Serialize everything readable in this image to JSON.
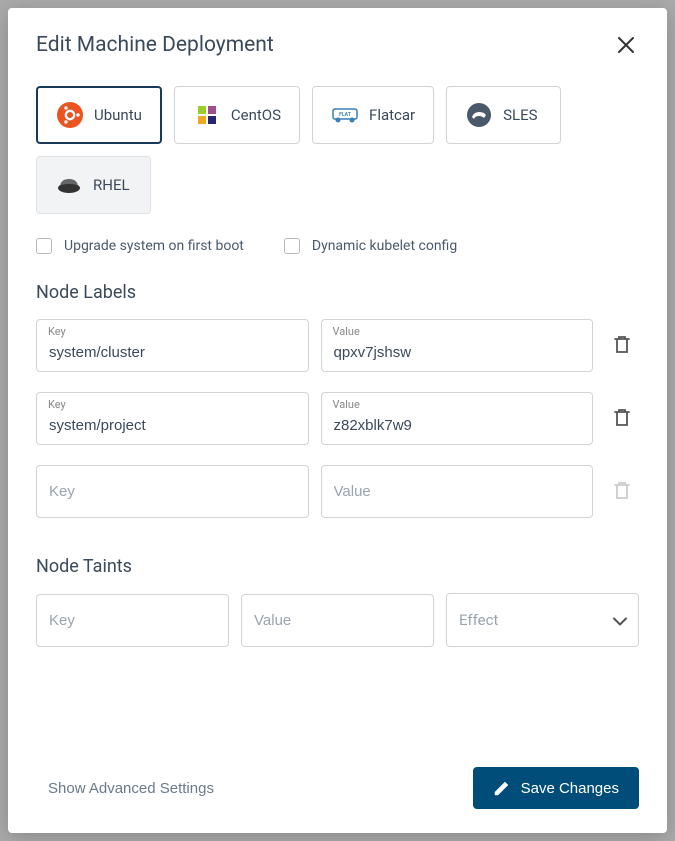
{
  "header": {
    "title": "Edit Machine Deployment"
  },
  "os_options": {
    "ubuntu": "Ubuntu",
    "centos": "CentOS",
    "flatcar": "Flatcar",
    "sles": "SLES",
    "rhel": "RHEL"
  },
  "checkboxes": {
    "upgrade": "Upgrade system on first boot",
    "dynamic_kubelet": "Dynamic kubelet config"
  },
  "sections": {
    "labels_title": "Node Labels",
    "taints_title": "Node Taints"
  },
  "labels": [
    {
      "key_label": "Key",
      "key": "system/cluster",
      "value_label": "Value",
      "value": "qpxv7jshsw"
    },
    {
      "key_label": "Key",
      "key": "system/project",
      "value_label": "Value",
      "value": "z82xblk7w9"
    }
  ],
  "empty_label": {
    "key_placeholder": "Key",
    "value_placeholder": "Value"
  },
  "taint": {
    "key_placeholder": "Key",
    "value_placeholder": "Value",
    "effect_placeholder": "Effect"
  },
  "footer": {
    "advanced": "Show Advanced Settings",
    "save": "Save Changes"
  }
}
